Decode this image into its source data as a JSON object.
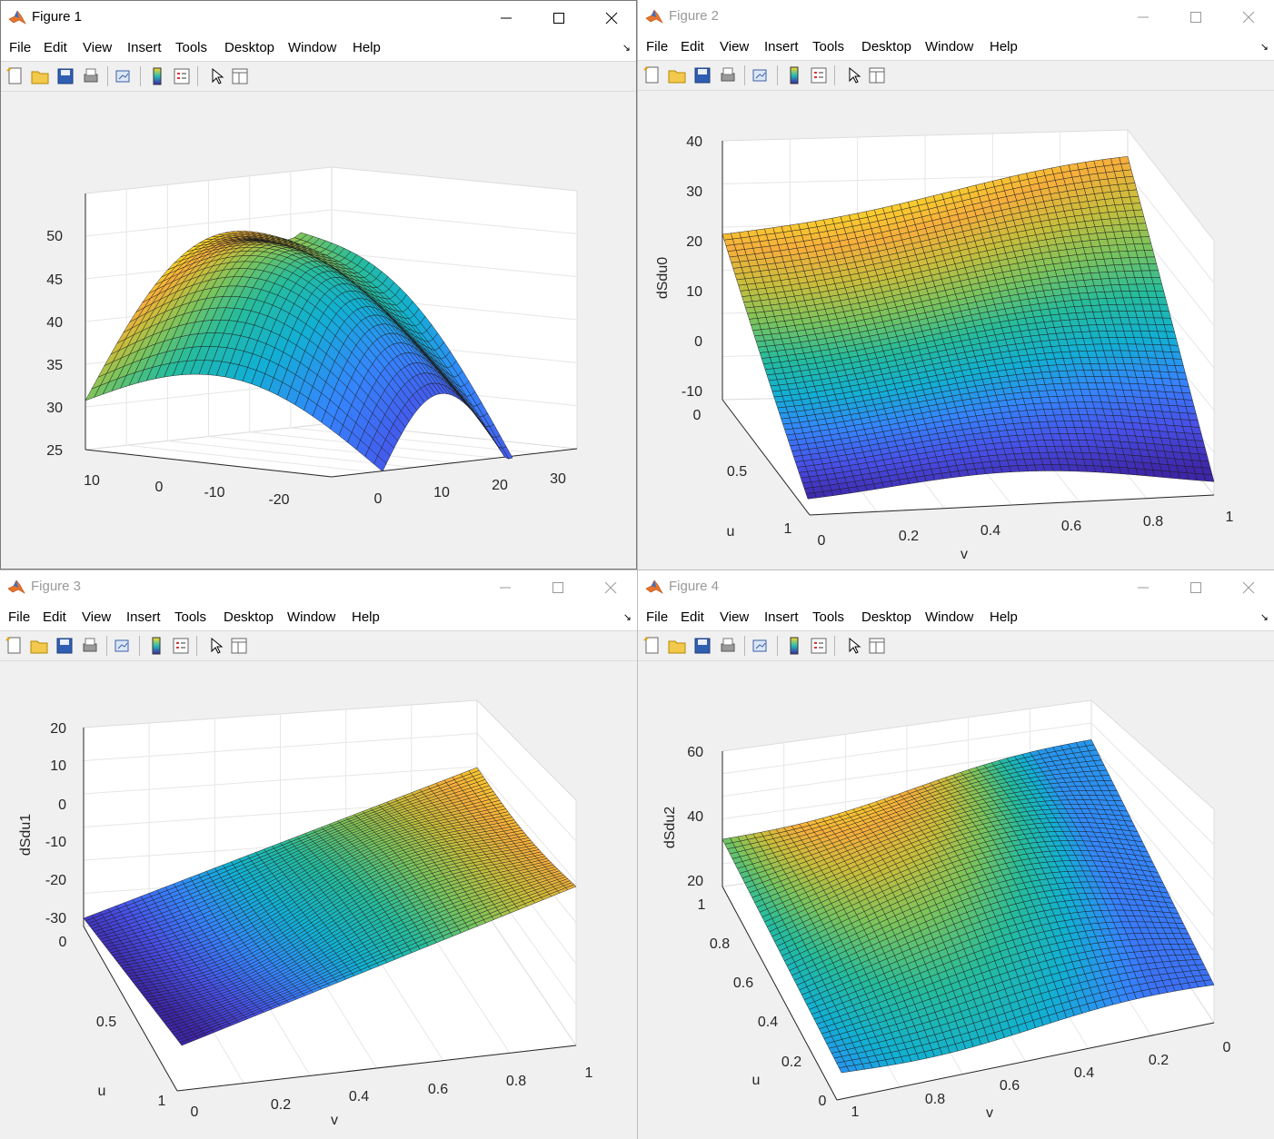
{
  "windows": [
    {
      "title": "Figure 1",
      "active": true,
      "plot": {
        "zlabel": "",
        "ulabel": "",
        "vlabel": "",
        "zticks": [
          "50",
          "45",
          "40",
          "35",
          "30",
          "25"
        ],
        "leftticks": [
          "10",
          "0",
          "-10",
          "-20"
        ],
        "rightticks": [
          "0",
          "10",
          "20",
          "30"
        ]
      }
    },
    {
      "title": "Figure 2",
      "active": false,
      "plot": {
        "zlabel": "dSdu0",
        "ulabel": "u",
        "vlabel": "v",
        "zticks": [
          "40",
          "30",
          "20",
          "10",
          "0",
          "-10"
        ],
        "leftticks": [
          "0",
          "0.5",
          "1"
        ],
        "rightticks": [
          "0",
          "0.2",
          "0.4",
          "0.6",
          "0.8",
          "1"
        ]
      }
    },
    {
      "title": "Figure 3",
      "active": false,
      "plot": {
        "zlabel": "dSdu1",
        "ulabel": "u",
        "vlabel": "v",
        "zticks": [
          "20",
          "10",
          "0",
          "-10",
          "-20",
          "-30"
        ],
        "leftticks": [
          "0",
          "0.5",
          "1"
        ],
        "rightticks": [
          "0",
          "0.2",
          "0.4",
          "0.6",
          "0.8",
          "1"
        ]
      }
    },
    {
      "title": "Figure 4",
      "active": false,
      "plot": {
        "zlabel": "dSdu2",
        "ulabel": "u",
        "vlabel": "v",
        "zticks": [
          "60",
          "40",
          "20"
        ],
        "leftticks": [
          "1",
          "0.8",
          "0.6",
          "0.4",
          "0.2",
          "0"
        ],
        "rightticks": [
          "1",
          "0.8",
          "0.6",
          "0.4",
          "0.2",
          "0"
        ]
      }
    }
  ],
  "menus": [
    "File",
    "Edit",
    "View",
    "Insert",
    "Tools",
    "Desktop",
    "Window",
    "Help"
  ],
  "toolbar_icons": [
    "new-figure-icon",
    "open-file-icon",
    "save-icon",
    "print-icon",
    "link-plot-icon",
    "insert-colorbar-icon",
    "insert-legend-icon",
    "edit-plot-icon",
    "property-inspector-icon"
  ],
  "colors": {
    "parula_low": "#3e26a8",
    "parula_mid": "#26bcb6",
    "parula_high": "#f9d927",
    "orange": "#e8a33b"
  }
}
